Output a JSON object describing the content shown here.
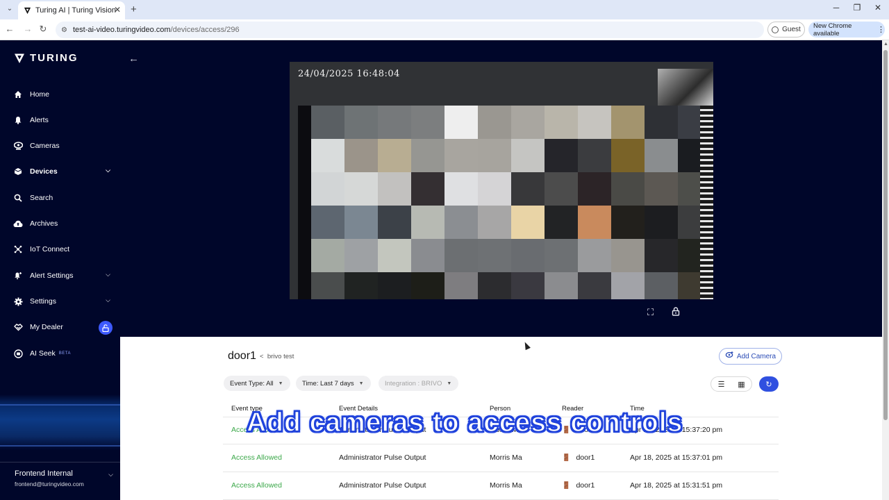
{
  "browser": {
    "tab_title": "Turing AI | Turing Vision",
    "url_host": "test-ai-video.turingvideo.com",
    "url_path": "/devices/access/296",
    "guest_label": "Guest",
    "update_label": "New Chrome available"
  },
  "sidebar": {
    "brand": "TURING",
    "items": [
      {
        "label": "Home",
        "icon": "home-icon"
      },
      {
        "label": "Alerts",
        "icon": "bell-icon"
      },
      {
        "label": "Cameras",
        "icon": "camera-icon"
      },
      {
        "label": "Devices",
        "icon": "device-icon"
      },
      {
        "label": "Search",
        "icon": "search-icon"
      },
      {
        "label": "Archives",
        "icon": "cloud-upload-icon"
      },
      {
        "label": "IoT Connect",
        "icon": "iot-icon"
      },
      {
        "label": "Alert Settings",
        "icon": "alert-settings-icon"
      },
      {
        "label": "Settings",
        "icon": "gear-icon"
      },
      {
        "label": "My Dealer",
        "icon": "dealer-icon"
      },
      {
        "label": "AI Seek",
        "icon": "ai-seek-icon"
      }
    ],
    "beta_label": "BETA",
    "account_name": "Frontend Internal",
    "account_email": "frontend@turingvideo.com"
  },
  "viewer": {
    "timestamp": "24/04/2025 16:48:04"
  },
  "device": {
    "name": "door1",
    "crumb_sep": "<",
    "parent": "brivo test",
    "add_camera_label": "Add Camera"
  },
  "filters": {
    "event_type": "Event Type: All",
    "time": "Time: Last 7 days",
    "integration": "Integration : BRIVO"
  },
  "table": {
    "headers": [
      "Event type",
      "Event Details",
      "Person",
      "Reader",
      "Time"
    ],
    "rows": [
      {
        "type": "Access Allowed",
        "details": "Administrator Pulse Output",
        "person": "Morris Ma",
        "reader": "door1",
        "time": "Apr 18, 2025 at 15:37:20 pm"
      },
      {
        "type": "Access Allowed",
        "details": "Administrator Pulse Output",
        "person": "Morris Ma",
        "reader": "door1",
        "time": "Apr 18, 2025 at 15:37:01 pm"
      },
      {
        "type": "Access Allowed",
        "details": "Administrator Pulse Output",
        "person": "Morris Ma",
        "reader": "door1",
        "time": "Apr 18, 2025 at 15:31:51 pm"
      }
    ]
  },
  "caption": "Add cameras to access controls",
  "colors": {
    "sidebar_bg": "#00062a",
    "accent": "#3050e0",
    "allowed": "#3ca84a"
  }
}
